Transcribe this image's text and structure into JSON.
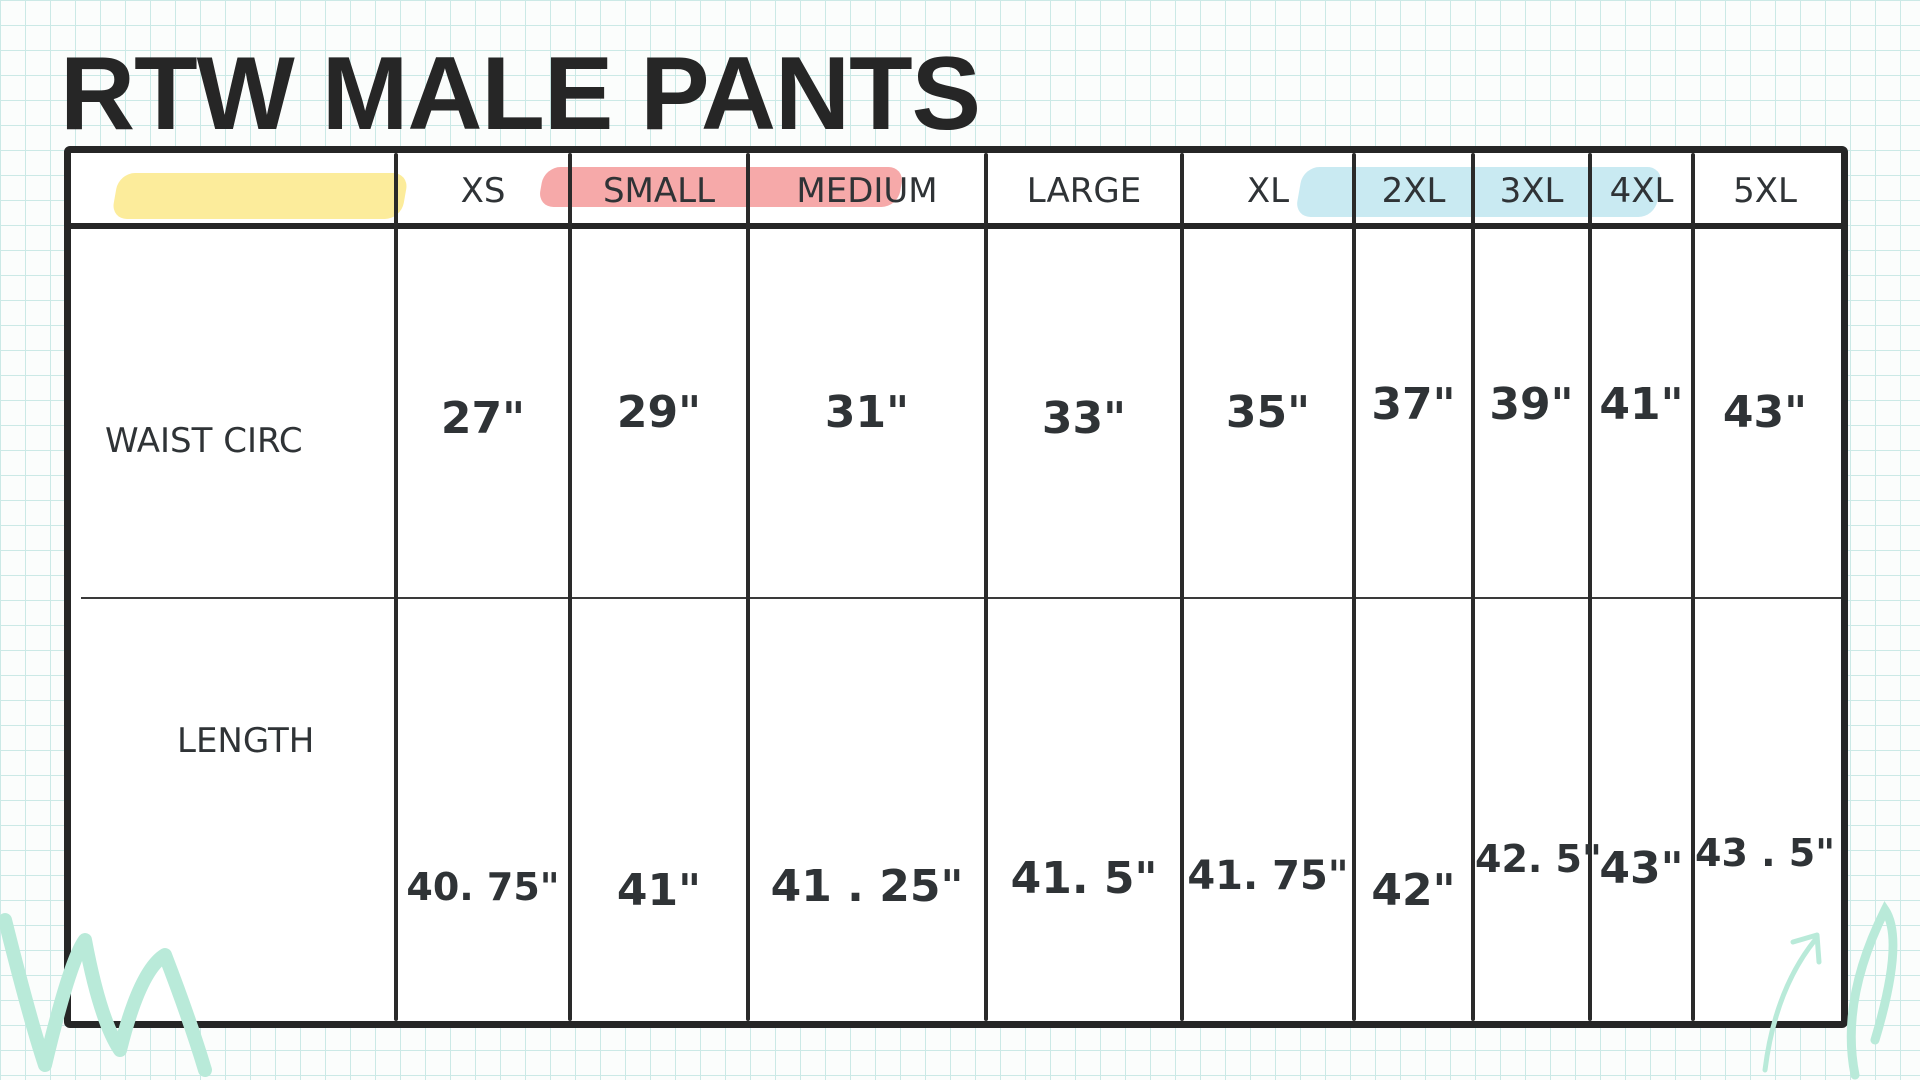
{
  "title": "RTW MALE PANTS",
  "sizes": [
    "XS",
    "SMALL",
    "MEDIUM",
    "LARGE",
    "XL",
    "2XL",
    "3XL",
    "4XL",
    "5XL"
  ],
  "rows": [
    {
      "label": "WAIST CIRC",
      "values": [
        "27\"",
        "29\"",
        "31\"",
        "33\"",
        "35\"",
        "37\"",
        "39\"",
        "41\"",
        "43\""
      ]
    },
    {
      "label": "LENGTH",
      "values": [
        "40. 75\"",
        "41\"",
        "41 . 25\"",
        "41. 5\"",
        "41. 75\"",
        "42\"",
        "42. 5\"",
        "43\"",
        "43 . 5\""
      ]
    }
  ],
  "colors": {
    "ink": "#262626",
    "highlight_yellow": "#fbe98a",
    "highlight_red": "#f59a9a",
    "highlight_blue": "#bfe6f0",
    "grid": "#cbe9e6",
    "doodle": "#b9ead9"
  }
}
